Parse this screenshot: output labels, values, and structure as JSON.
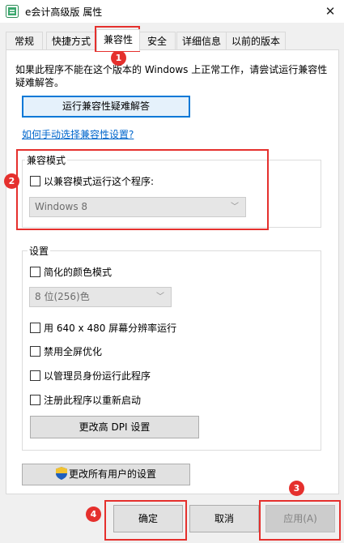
{
  "window": {
    "title": "e会计高级版 属性",
    "close_symbol": "✕"
  },
  "tabs": [
    {
      "label": "常规"
    },
    {
      "label": "快捷方式"
    },
    {
      "label": "兼容性"
    },
    {
      "label": "安全"
    },
    {
      "label": "详细信息"
    },
    {
      "label": "以前的版本"
    }
  ],
  "intro": {
    "text": "如果此程序不能在这个版本的 Windows 上正常工作，请尝试运行兼容性疑难解答。"
  },
  "troubleshoot_button": "运行兼容性疑难解答",
  "manual_link": "如何手动选择兼容性设置?",
  "compat_mode": {
    "group_label": "兼容模式",
    "checkbox_label": "以兼容模式运行这个程序:",
    "select_value": "Windows 8"
  },
  "settings": {
    "group_label": "设置",
    "reduced_color": "简化的颜色模式",
    "color_select_value": "8 位(256)色",
    "res_640": "用 640 x 480 屏幕分辨率运行",
    "disable_fullscreen": "禁用全屏优化",
    "run_as_admin": "以管理员身份运行此程序",
    "register_restart": "注册此程序以重新启动",
    "dpi_button": "更改高 DPI 设置"
  },
  "all_users_button": "更改所有用户的设置",
  "footer": {
    "ok": "确定",
    "cancel": "取消",
    "apply": "应用(A)"
  },
  "annotations": {
    "b1": "1",
    "b2": "2",
    "b3": "3",
    "b4": "4"
  },
  "colors": {
    "annotation_red": "#e5302d",
    "link_blue": "#0066cc",
    "focus_blue": "#0078d7"
  }
}
